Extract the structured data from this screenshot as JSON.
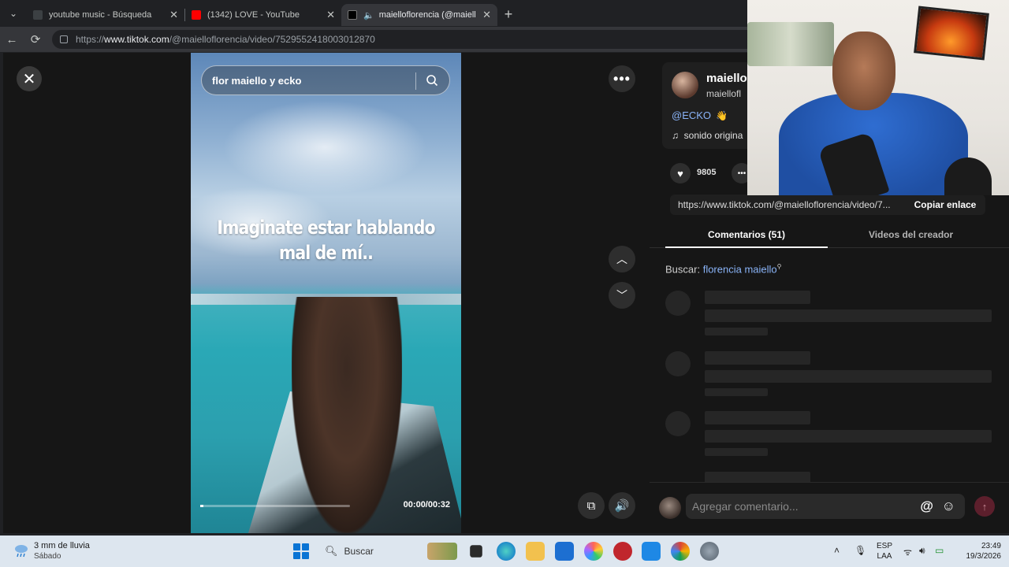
{
  "browser": {
    "tabs": [
      {
        "title": "youtube music - Búsqueda",
        "active": false,
        "favicon": "search-favicon"
      },
      {
        "title": "(1342) LOVE - YouTube",
        "active": false,
        "favicon": "youtube-favicon"
      },
      {
        "title": "maiellofloren‌cia (@maiellofloren",
        "active": true,
        "favicon": "tiktok-favicon"
      }
    ],
    "url_prefix": "https://",
    "url_host": "www.tiktok.com",
    "url_path": "/@maiellofloren‌cia/video/7529552418003012870"
  },
  "video": {
    "search_text": "flor maiello y ecko",
    "overlay_line1": "Imaginate estar hablando",
    "overlay_line2": "mal de mí..",
    "time": "00:00/00:32",
    "progress": 0.02
  },
  "panel": {
    "profile_name": "maiello",
    "profile_user": "maiellofl",
    "mention": "@ECKO",
    "sound": "sonido origina",
    "likes": "9805",
    "link": "https://www.tiktok.com/@maiellofloren‌cia/video/7...",
    "copy_label": "Copiar enlace",
    "tab_comments": "Comentarios (51)",
    "tab_videos": "Videos del creador",
    "search_prefix": "Buscar:",
    "search_query": "florencia maiello",
    "comment_placeholder": "Agregar comentario..."
  },
  "taskbar": {
    "weather_line1": "3 mm de lluvia",
    "weather_line2": "Sábado",
    "search_label": "Buscar",
    "lang1": "ESP",
    "lang2": "LAA",
    "time": "23:49",
    "date": "19/3/2026"
  },
  "colors": {
    "accent_link": "#8ab4f8",
    "tiktok_send": "#5c1f2c",
    "taskbar_bg": "#dde6ef"
  }
}
